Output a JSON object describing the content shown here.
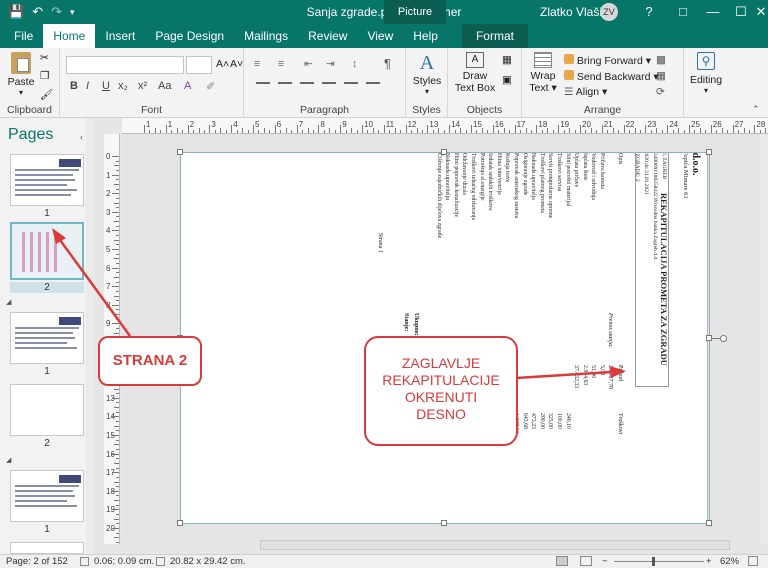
{
  "window": {
    "title": "Sanja zgrade.pub - Publisher",
    "context_tab": "Picture Tools",
    "user_name": "Zlatko Vlašić",
    "user_initials": "ZV",
    "help": "?",
    "colors": {
      "accent": "#077568",
      "callout": "#d93a3a"
    }
  },
  "tabs": [
    "File",
    "Home",
    "Insert",
    "Page Design",
    "Mailings",
    "Review",
    "View",
    "Help",
    "Format"
  ],
  "ribbon": {
    "clipboard": {
      "paste": "Paste",
      "label": "Clipboard"
    },
    "font": {
      "label": "Font",
      "bold": "B",
      "italic": "I",
      "underline": "U",
      "strike": "x₂",
      "superscript": "x²",
      "case": "Aa",
      "grow": "A˄",
      "shrink": "A˅"
    },
    "paragraph": {
      "label": "Paragraph",
      "pilcrow": "¶"
    },
    "styles": {
      "button": "Styles",
      "label": "Styles"
    },
    "objects": {
      "draw_text_box": "Draw\nText Box",
      "draw_line1": "Draw",
      "draw_line2": "Text Box",
      "label": "Objects"
    },
    "arrange": {
      "wrap_text1": "Wrap",
      "wrap_text2": "Text",
      "bring_forward": "Bring Forward",
      "send_backward": "Send Backward",
      "align": "Align",
      "label": "Arrange"
    },
    "editing": {
      "button": "Editing"
    }
  },
  "pages_panel": {
    "title": "Pages",
    "thumbs": [
      {
        "num": "1"
      },
      {
        "num": "2"
      },
      {
        "num": "1"
      },
      {
        "num": "2"
      },
      {
        "num": "1"
      }
    ]
  },
  "ruler": {
    "h_numbers": [
      "1",
      "1",
      "2",
      "3",
      "4",
      "5",
      "6",
      "7",
      "8",
      "9",
      "10",
      "11",
      "12",
      "13",
      "14",
      "15",
      "16",
      "17",
      "18",
      "19",
      "20",
      "21",
      "22",
      "23",
      "24",
      "25",
      "26",
      "27",
      "28",
      "29"
    ],
    "v_numbers": [
      "0",
      "1",
      "2",
      "3",
      "4",
      "5",
      "6",
      "7",
      "8",
      "9",
      "10",
      "11",
      "12",
      "13",
      "14",
      "15",
      "16",
      "17",
      "18",
      "19",
      "20"
    ]
  },
  "document": {
    "company": "ZAPAD-STAN d.o.o.",
    "address1": "upravljanje zgradama A.Topića Mimare 61",
    "address2": "10090 ZAGREB",
    "heading": "REKAPITULACIJA PROMETA ZA ZGRADU",
    "info_rows": [
      {
        "k": "ZGRADA",
        "v": "Anina 6, ZAGREB"
      },
      {
        "k": "ŽIRO RAČUN",
        "v": "HR7823400091100358422 Privredna banka Zagreb d.d."
      },
      {
        "k": "RAZDOBLJE",
        "v": "01.02.2020 do 31.01.2021"
      }
    ],
    "extra_line": "ŠIFRA ZGRADE: 2",
    "col_vrsta": "Vrsta naloga",
    "col_opis": "Opis",
    "col_prihod": "Prihod",
    "col_troskovi": "Troškovi",
    "prenos_label": "Prenos stanja:",
    "prenos_value": "26.887,78",
    "rows": [
      {
        "code": "PKTA",
        "desc": "Pričuva kamata",
        "prihod": "5,08",
        "trosak": ""
      },
      {
        "code": "VS",
        "desc": "Vodovod i odvodnja",
        "prihod": "51,96",
        "trosak": ""
      },
      {
        "code": "IS",
        "desc": "Isplata štete",
        "prihod": "2.944,63",
        "trosak": ""
      },
      {
        "code": "UPL",
        "desc": "Uplata pričuve",
        "prihod": "37.432,33",
        "trosak": ""
      },
      {
        "code": "SPM",
        "desc": "Sitni potrošni materijal",
        "prihod": "",
        "trosak": "246,10"
      },
      {
        "code": "TSV",
        "desc": "Troškovi servisa",
        "prihod": "",
        "trosak": "100,00"
      },
      {
        "code": "105",
        "desc": "Servis protupožarne opreme",
        "prihod": "",
        "trosak": "325,00"
      },
      {
        "code": "TPP",
        "desc": "Troškovi platnog prometa",
        "prihod": "",
        "trosak": "200,00"
      },
      {
        "code": "81",
        "desc": "Naknada upravitelja",
        "prihod": "",
        "trosak": "473,23"
      },
      {
        "code": "81",
        "desc": "Osiguranje zgrade",
        "prihod": "",
        "trosak": "643,68"
      },
      {
        "code": "PA",
        "desc": "Popravak antenskog sustava",
        "prihod": "",
        "trosak": "1.227,63"
      },
      {
        "code": "KS",
        "desc": "Košnja trave",
        "prihod": "",
        "trosak": "1.500,00"
      },
      {
        "code": "1082",
        "desc": "Hitna intervencija",
        "prihod": "",
        "trosak": "1.687,50"
      },
      {
        "code": "",
        "desc": "Izdatak sudskih troškova",
        "prihod": "",
        "trosak": "1.937,60"
      },
      {
        "code": "1",
        "desc": "Potrošnja el.energije",
        "prihod": "",
        "trosak": "2.500,00"
      },
      {
        "code": "TT",
        "desc": "Troškovi tekućeg održavanja",
        "prihod": "",
        "trosak": "3.092,25"
      },
      {
        "code": "T",
        "desc": "Održavanje dizala",
        "prihod": "",
        "trosak": "3.007,23"
      },
      {
        "code": "TI1",
        "desc": "Hitni popravak kanalizacije",
        "prihod": "",
        "trosak": "3.776,02"
      },
      {
        "code": "NAKND",
        "desc": "Naknada upravitelju",
        "prihod": "",
        "trosak": "4.013,30"
      },
      {
        "code": "37",
        "desc": "Čišćenje zajedničkih dijelova zgrade",
        "prihod": "",
        "trosak": "4.276,32"
      }
    ],
    "last_extra": "5.000,00",
    "ukupno_label": "Ukupno:",
    "ukupno_prihod": "67.237,38",
    "ukupno_trosak": "34.005,06",
    "stanje_label": "Stanje:",
    "stanje_value": "33.232,32",
    "place_date": "Zagreb, 01.02.2021",
    "strana": "Strana 1"
  },
  "callouts": {
    "strana": "STRANA 2",
    "zaglavlje_l1": "ZAGLAVLJE",
    "zaglavlje_l2": "REKAPITULACIJE",
    "zaglavlje_l3": "OKRENUTI",
    "zaglavlje_l4": "DESNO"
  },
  "status": {
    "page": "Page: 2 of 152",
    "position": "0.06; 0.09 cm.",
    "size": "20.82 x 29.42 cm.",
    "zoom": "62%",
    "minus": "−",
    "plus": "+"
  }
}
